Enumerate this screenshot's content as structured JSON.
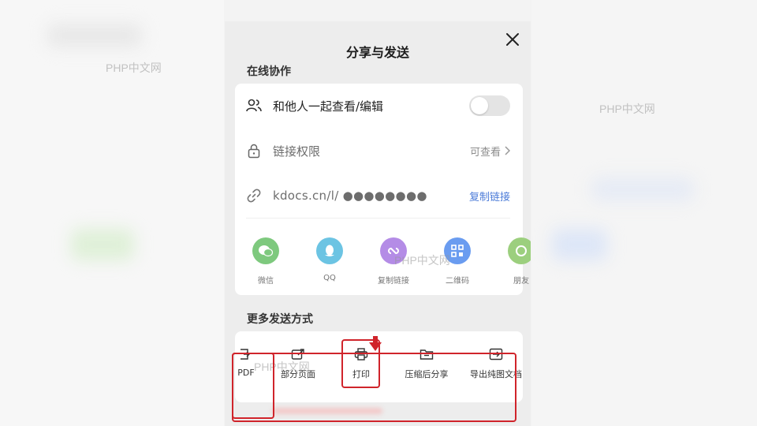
{
  "watermarks": [
    "PHP中文网",
    "PHP中文网",
    "PHP中文网",
    "PHP中文网"
  ],
  "sheet": {
    "title": "分享与发送",
    "close_icon": "close-icon"
  },
  "online": {
    "section_title": "在线协作",
    "view_edit_label": "和他人一起查看/编辑",
    "toggle_on": false,
    "permission_label": "链接权限",
    "permission_value": "可查看",
    "link_text": "kdocs.cn/l/ ●●●●●●●●",
    "copy_link": "复制链接"
  },
  "share_targets": [
    {
      "label": "微信",
      "icon": "wechat-icon",
      "color": "#7ec97e"
    },
    {
      "label": "QQ",
      "icon": "qq-icon",
      "color": "#6cc4e3"
    },
    {
      "label": "复制链接",
      "icon": "miniprogram-link-icon",
      "color": "#b48ce6"
    },
    {
      "label": "二维码",
      "icon": "qrcode-icon",
      "color": "#6a9cf0"
    },
    {
      "label": "朋友",
      "icon": "moments-icon",
      "color": "#9ccf7e"
    }
  ],
  "more": {
    "section_title": "更多发送方式",
    "items": [
      {
        "label": "PDF",
        "icon": "pdf-export-icon"
      },
      {
        "label": "部分页面",
        "icon": "partial-page-share-icon"
      },
      {
        "label": "打印",
        "icon": "print-icon"
      },
      {
        "label": "压缩后分享",
        "icon": "compress-share-icon"
      },
      {
        "label": "导出纯图文档",
        "icon": "export-image-doc-icon"
      }
    ]
  },
  "accent_red": "#d0242b",
  "accent_blue": "#4b7bd8"
}
